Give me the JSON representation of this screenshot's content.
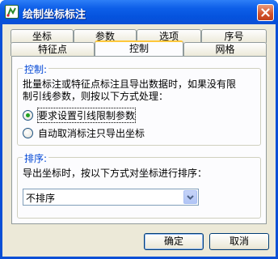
{
  "window": {
    "title": "绘制坐标标注",
    "icon": "app-icon",
    "close_icon": "close-icon"
  },
  "tabs": {
    "back_row": [
      "坐标",
      "参数",
      "选项",
      "序号"
    ],
    "front_row": [
      "特征点",
      "控制",
      "网格"
    ],
    "active": "控制"
  },
  "control_group": {
    "caption": "控制:",
    "description_line1": "批量标注或特征点标注且导出数据时，如果没有限",
    "description_line2": "制引线参数，则按以下方式处理：",
    "options": [
      {
        "label": "要求设置引线限制参数",
        "checked": true
      },
      {
        "label": "自动取消标注只导出坐标",
        "checked": false
      }
    ]
  },
  "sort_group": {
    "caption": "排序:",
    "description": "导出坐标时，按以下方式对坐标进行排序：",
    "select_value": "不排序",
    "dropdown_icon": "chevron-down-icon"
  },
  "buttons": {
    "ok": "确定",
    "cancel": "取消"
  },
  "colors": {
    "titlebar": "#0a4fd6",
    "active_tab_accent": "#ffc83c",
    "group_caption": "#0046d5",
    "radio_checked": "#21a121"
  }
}
